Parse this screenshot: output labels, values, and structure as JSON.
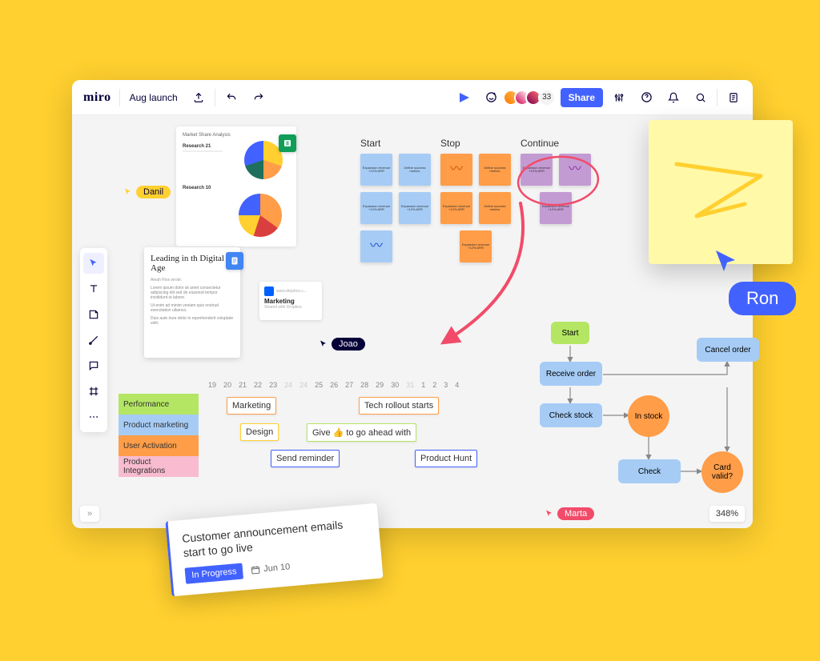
{
  "app": {
    "name": "miro",
    "board_name": "Aug launch"
  },
  "topbar": {
    "share_label": "Share",
    "presence_count": "33"
  },
  "cursors": {
    "danil": "Danil",
    "joao": "Joao",
    "marta": "Marta",
    "ron": "Ron"
  },
  "stickies": {
    "cols": {
      "start": "Start",
      "stop": "Stop",
      "continue": "Continue"
    },
    "content": "Expansion revenue +12% ARR",
    "success": "Define success metrics"
  },
  "docs": {
    "lead_title": "Leading in th Digital Age",
    "lead_sub": "Aleah Rios wrote:",
    "research1": "Research 21",
    "research2": "Research 10",
    "mkt_title": "Marketing",
    "mkt_sub": "Shared with Dropbox"
  },
  "flow": {
    "start": "Start",
    "receive": "Receive order",
    "check_stock": "Check stock",
    "in_stock": "In stock",
    "cancel": "Cancel order",
    "check": "Check",
    "card_valid": "Card valid?"
  },
  "timeline": {
    "dates": [
      "19",
      "20",
      "21",
      "22",
      "23",
      "24",
      "24",
      "25",
      "26",
      "27",
      "28",
      "29",
      "30",
      "31",
      "1",
      "2",
      "3",
      "4"
    ],
    "muted_idx": [
      5,
      6,
      13
    ],
    "categories": [
      "Performance",
      "Product marketing",
      "User Activation",
      "Product Integrations"
    ],
    "tasks": {
      "marketing": "Marketing",
      "tech": "Tech rollout starts",
      "design": "Design",
      "give": "Give 👍 to go ahead with",
      "send": "Send reminder",
      "hunt": "Product Hunt"
    }
  },
  "card": {
    "title": "Customer announcement emails start to go live",
    "status": "In Progress",
    "due": "Jun 10"
  },
  "zoom": "348%"
}
